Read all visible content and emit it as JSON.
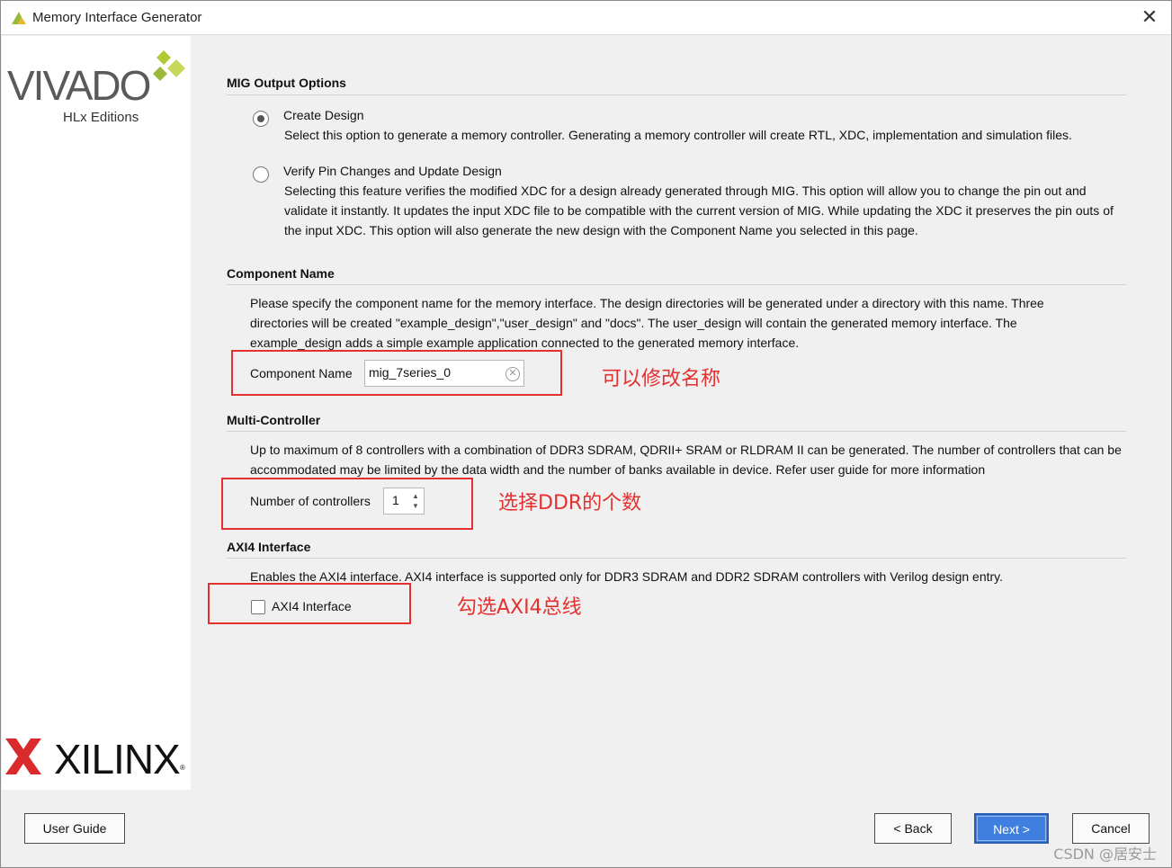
{
  "window": {
    "title": "Memory Interface Generator"
  },
  "branding": {
    "vivado_word": "VIVADO",
    "vivado_sub": "HLx Editions",
    "xilinx_word": "XILINX",
    "xilinx_reg": "®"
  },
  "output_options": {
    "title": "MIG Output Options",
    "create": {
      "label": "Create Design",
      "selected": true,
      "desc": "Select this option to generate a memory controller. Generating a memory controller will create RTL, XDC, implementation and simulation files."
    },
    "verify": {
      "label": "Verify Pin Changes and Update Design",
      "selected": false,
      "desc": "Selecting this feature verifies the modified XDC for a design already generated through MIG. This option will allow you to change the pin out and validate it instantly. It updates the input XDC file to be compatible with the current version of MIG. While updating the XDC it preserves the pin outs of the input XDC. This option will also generate the new design with the Component Name you selected in this page."
    }
  },
  "component": {
    "title": "Component Name",
    "desc": "Please specify the component name for the memory interface. The design directories will be generated under a directory with this name. Three directories will be created \"example_design\",\"user_design\" and \"docs\". The user_design will contain the generated memory interface. The example_design adds a simple example application connected to the generated memory interface.",
    "field_label": "Component Name",
    "value": "mig_7series_0"
  },
  "multi": {
    "title": "Multi-Controller",
    "desc": "Up to maximum of 8 controllers with a combination of DDR3 SDRAM, QDRII+ SRAM or RLDRAM II can be generated. The number of controllers that can be accommodated may be limited by the data width and the number of banks available in device. Refer user guide for more information",
    "field_label": "Number of controllers",
    "value": "1"
  },
  "axi": {
    "title": "AXI4 Interface",
    "desc": "Enables the AXI4 interface. AXI4 interface is supported only for DDR3 SDRAM and DDR2 SDRAM controllers with Verilog design entry.",
    "checkbox_label": "AXI4 Interface",
    "checked": false
  },
  "annotations": {
    "a1": "可以修改名称",
    "a2": "选择DDR的个数",
    "a3": "勾选AXI4总线"
  },
  "buttons": {
    "user_guide": "User Guide",
    "back": "< Back",
    "next": "Next >",
    "cancel": "Cancel"
  },
  "watermark": "CSDN @居安士",
  "colors": {
    "annotation": "#e53030",
    "primary_button": "#3e7fe0"
  }
}
